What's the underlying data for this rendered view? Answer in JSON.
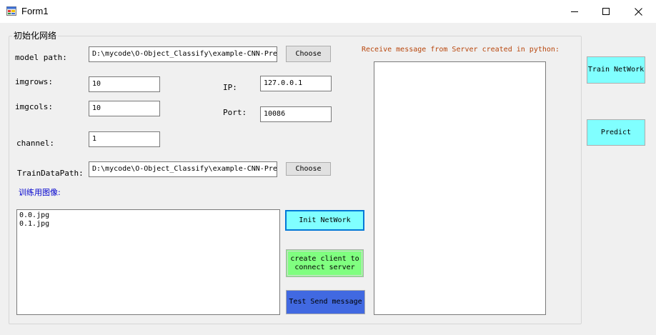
{
  "window": {
    "title": "Form1",
    "icon": "winforms-app-icon",
    "controls": [
      "minimize-icon",
      "maximize-icon",
      "close-icon"
    ]
  },
  "group": {
    "title": "初始化网络"
  },
  "model_path": {
    "label": "model path:",
    "value": "D:\\mycode\\O-Object_Classify\\example-CNN-Pre",
    "button": "Choose"
  },
  "imgrows": {
    "label": "imgrows:",
    "value": "10"
  },
  "imgcols": {
    "label": "imgcols:",
    "value": "10"
  },
  "channel": {
    "label": "channel:",
    "value": "1"
  },
  "ip": {
    "label": "IP:",
    "value": "127.0.0.1"
  },
  "port": {
    "label": "Port:",
    "value": "10086"
  },
  "train_data_path": {
    "label": "TrainDataPath:",
    "value": "D:\\mycode\\O-Object_Classify\\example-CNN-Pre",
    "button": "Choose"
  },
  "train_images": {
    "label": "训练用图像:",
    "items": [
      "0.0.jpg",
      "0.1.jpg"
    ]
  },
  "buttons": {
    "init_network": "Init NetWork",
    "create_client": "create client to connect server",
    "test_send": "Test Send message",
    "train_network": "Train NetWork",
    "predict": "Predict"
  },
  "server_output": {
    "label": "Receive message from Server created in python:",
    "text": ""
  },
  "colors": {
    "cyan_button": "#80ffff",
    "green_button": "#80ff80",
    "blue_button": "#4169e1",
    "blue_label": "#0000cd",
    "orange_label": "#b8460c",
    "focus_border": "#0078d7"
  }
}
